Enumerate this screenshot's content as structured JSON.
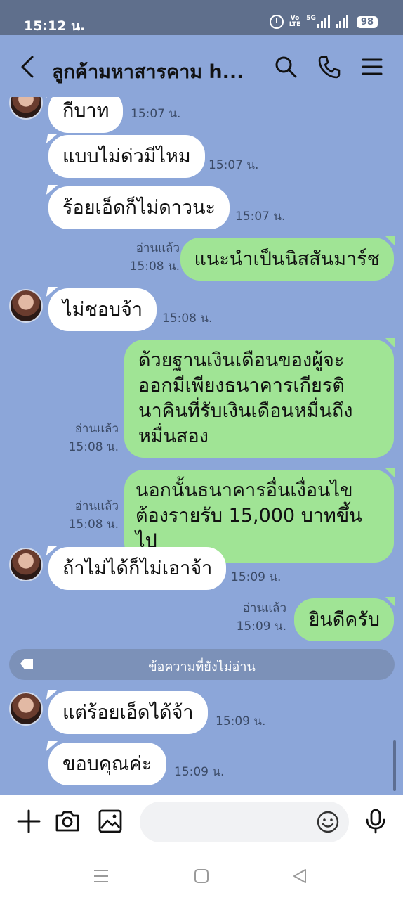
{
  "status_bar": {
    "time": "15:12 น.",
    "volte_top": "Vo",
    "volte_bottom": "LTE",
    "network": "5G",
    "battery": "98"
  },
  "header": {
    "title": "ลูกค้ามหาสารคาม h..."
  },
  "messages": [
    {
      "side": "in",
      "text": "กีบาท",
      "time": "15:07 น."
    },
    {
      "side": "in",
      "text": "แบบไม่ด่วมีไหม",
      "time": "15:07 น."
    },
    {
      "side": "in",
      "text": "ร้อยเอ็ดก็ไม่ดาวนะ",
      "time": "15:07 น."
    },
    {
      "side": "out",
      "text": "แนะนำเป็นนิสสันมาร์ช",
      "read": "อ่านแล้ว",
      "time": "15:08 น."
    },
    {
      "side": "in",
      "text": "ไม่ชอบจ้า",
      "time": "15:08 น."
    },
    {
      "side": "out",
      "lines": [
        "ด้วยฐานเงินเดือนของผู้จะ",
        "ออกมีเพียงธนาคารเกียรติ",
        "นาคินที่รับเงินเดือนหมื่นถึง",
        "หมื่นสอง"
      ],
      "read": "อ่านแล้ว",
      "time": "15:08 น."
    },
    {
      "side": "out",
      "lines": [
        "นอกนั้นธนาคารอื่นเงื่อนไข",
        "ต้องรายรับ 15,000 บาทขึ้นไป"
      ],
      "read": "อ่านแล้ว",
      "time": "15:08 น."
    },
    {
      "side": "in",
      "text": "ถ้าไม่ได้ก็ไม่เอาจ้า",
      "time": "15:09 น."
    },
    {
      "side": "out",
      "text": "ยินดีครับ",
      "read": "อ่านแล้ว",
      "time": "15:09 น."
    },
    {
      "side": "in",
      "text": "แต่ร้อยเอ็ดได้จ้า",
      "time": "15:09 น."
    },
    {
      "side": "in",
      "text": "ขอบคุณค่ะ",
      "time": "15:09 น."
    }
  ],
  "unread_divider": "ข้อความที่ยังไม่อ่าน",
  "input": {
    "value": ""
  },
  "colors": {
    "chat_background": "#8ca6d9",
    "status_bar": "#5f6f8c",
    "outgoing_bubble": "#a0e495",
    "incoming_bubble": "#ffffff"
  },
  "icons": [
    "back-icon",
    "search-icon",
    "phone-icon",
    "menu-icon",
    "plus-icon",
    "camera-icon",
    "image-icon",
    "emoji-icon",
    "mic-icon"
  ]
}
